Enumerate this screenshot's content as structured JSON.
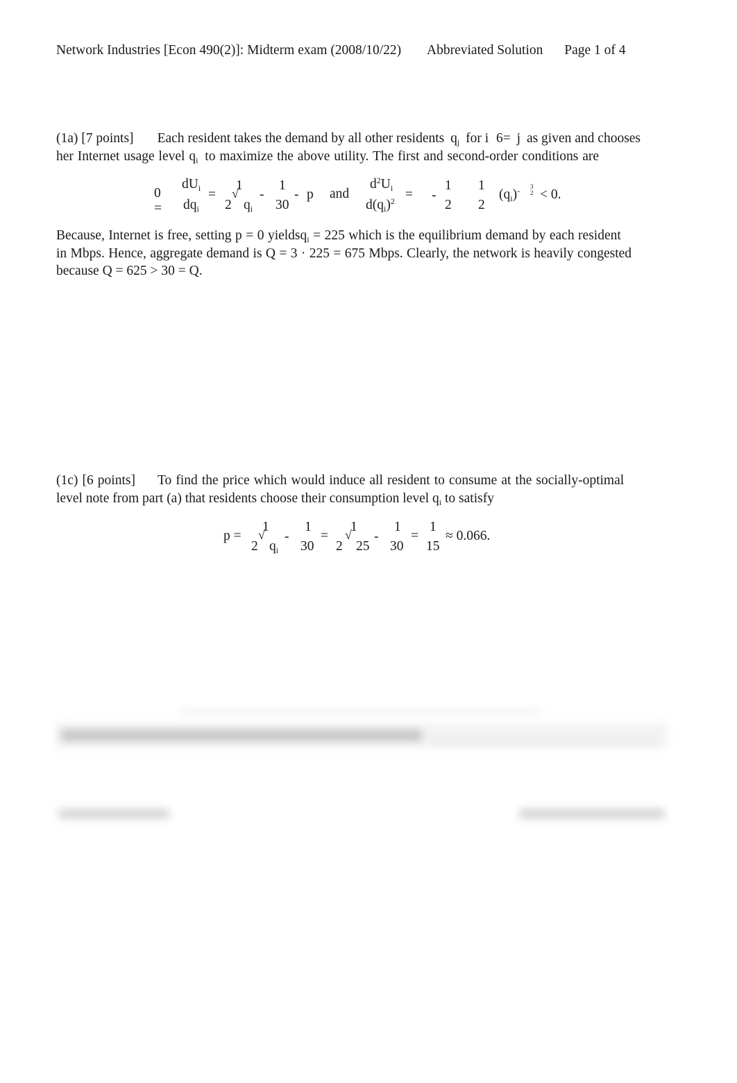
{
  "header": {
    "title": "Network Industries [Econ 490(2)]: Midterm exam (2008/10/22)",
    "solution_label": "Abbreviated Solution",
    "page_label": "Page 1 of 4"
  },
  "part_1a": {
    "label": "(1a) [7 points]",
    "line1_a": "Each resident takes the demand by all other residents",
    "q": "q",
    "sub_j": "j",
    "line1_b": "for i",
    "neq": "6=",
    "j": "j",
    "line1_c": "as given and chooses",
    "line2_a": "her Internet usage level",
    "sub_i": "i",
    "line2_b": "to maximize the above utility. The first and second-order conditions are",
    "equation": {
      "zero_eq": "0 =",
      "dU": "dU",
      "dq": "dq",
      "i": "i",
      "eq": "=",
      "one": "1",
      "two": "2",
      "sqrt": "√",
      "minus": "-",
      "thirty": "30",
      "p": "p",
      "and": "and",
      "d2": "d",
      "sq": "2",
      "U": "U",
      "dq_paren": "d(q",
      "close_sq": ")",
      "qi_paren": "(q",
      "close": ")",
      "exp_minus": "-",
      "three": "3",
      "lt_zero": "<  0."
    },
    "para2": {
      "l1_a": "Because, Internet is free, setting p = 0  yields",
      "l1_b": "= 225  which is the equilibrium demand by each resident",
      "l2_a": "in Mbps. Hence, aggregate demand is",
      "l2_b": "Q  = 3 · 225 = 675 Mbps. Clearly, the network is heavily congested",
      "l3": "because Q = 625  >  30 =  Q."
    }
  },
  "part_1c": {
    "label": "(1c) [6 points]",
    "line1": "To find the price which would induce all resident to consume at the socially-optimal",
    "line2_a": "level note from part (a) that residents choose their consumption level",
    "line2_b": "to satisfy",
    "equation": {
      "p_eq": "p =",
      "one": "1",
      "two": "2",
      "sqrt": "√",
      "q": "q",
      "i": "i",
      "minus": "-",
      "thirty": "30",
      "eq": "=",
      "twentyfive": "25",
      "fifteen": "15",
      "approx": "≈  0.066."
    }
  }
}
